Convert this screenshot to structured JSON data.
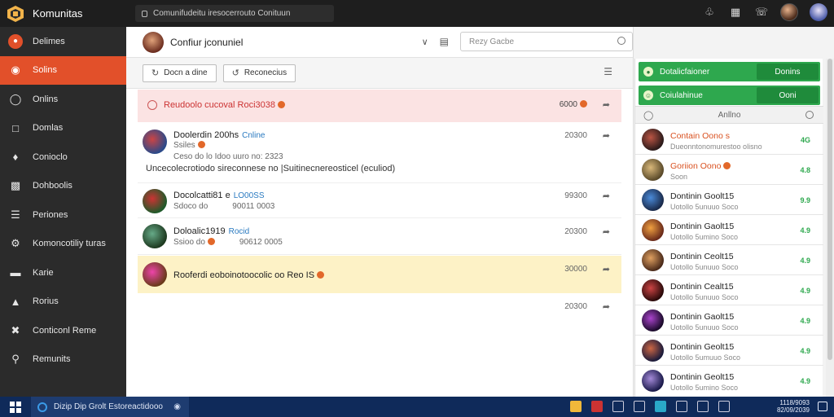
{
  "app": {
    "brand": "Komunitas",
    "url": "Comunifudeitu iresocerrouto Conituun"
  },
  "colors": {
    "accent": "#e2502a",
    "green": "#2ea84e",
    "alert_bg": "#fbe3e3",
    "highlight_bg": "#fdf2c6"
  },
  "sidebar": {
    "items": [
      {
        "label": "Delimes",
        "icon": "home-icon"
      },
      {
        "label": "Solins",
        "icon": "chat-icon",
        "active": true
      },
      {
        "label": "Onlins",
        "icon": "circle-icon"
      },
      {
        "label": "Domlas",
        "icon": "chat-bubble-icon"
      },
      {
        "label": "Conioclo",
        "icon": "puzzle-icon"
      },
      {
        "label": "Dohboolis",
        "icon": "chart-icon"
      },
      {
        "label": "Periones",
        "icon": "list-icon"
      },
      {
        "label": "Komoncotiliy turas",
        "icon": "gear-icon"
      },
      {
        "label": "Karie",
        "icon": "card-icon"
      },
      {
        "label": "Rorius",
        "icon": "image-icon"
      },
      {
        "label": "Conticonl Reme",
        "icon": "wrench-icon"
      },
      {
        "label": "Remunits",
        "icon": "pin-icon"
      }
    ]
  },
  "header": {
    "title": "Confiur jconuniel",
    "search_placeholder": "Rezy Gacbe"
  },
  "toolbar": {
    "btn1": "Docn a dine",
    "btn2": "Reconecius"
  },
  "messages": [
    {
      "type": "alert",
      "text": "Reudoolo cucoval Roci3038",
      "time": "6000"
    },
    {
      "name": "Doolerdin 200hs",
      "tag": "Cnline",
      "sub1": "Ssiles",
      "sub2": "Ceso do lo Idoo uuro no: 2323",
      "body": "Uncecolecrotiodo sireconnese no  |Suitinecnereosticel (eculiod)",
      "time": "20300"
    },
    {
      "name": "Docolcatti81 e",
      "tag": "LO00SS",
      "sub1": "Sdoco do",
      "sub2": "90011 0003",
      "time": "99300"
    },
    {
      "name": "Doloalic1919",
      "tag": "Rocid",
      "sub1": "Ssioo do",
      "sub2": "90612 0005",
      "time": "20300"
    },
    {
      "type": "highlight",
      "text": "Rooferdi eoboinotoocolic oo  Reo IS",
      "time": "30000"
    },
    {
      "time": "20300"
    }
  ],
  "rpanel": {
    "bar1": {
      "label": "Dotalicfaioner",
      "btn": "Donins"
    },
    "bar2": {
      "label": "Coiulahinue",
      "btn": "Ooni"
    },
    "head": "Anllno",
    "items": [
      {
        "name": "Contain Oono",
        "suffix": "s",
        "sub": "Dueonntonomurestoo olisno",
        "badge": "4G",
        "hl": true
      },
      {
        "name": "Goriion Oono",
        "sub": "Soon",
        "badge": "4.8",
        "hl": true
      },
      {
        "name": "Dontinin Goolt15",
        "sub": "Uotollo 5unuuo Soco",
        "badge": "9.9"
      },
      {
        "name": "Dontinin Gaolt15",
        "sub": "Uotollo 5umino Soco",
        "badge": "4.9"
      },
      {
        "name": "Dontinin Ceolt15",
        "sub": "Uotollo 5unuuo Soco",
        "badge": "4.9"
      },
      {
        "name": "Dontinin Cealt15",
        "sub": "Uotollo 5unuuo Soco",
        "badge": "4.9"
      },
      {
        "name": "Dontinin Gaolt15",
        "sub": "Uotollo 5unuuo Soco",
        "badge": "4.9"
      },
      {
        "name": "Dontinin Geolt15",
        "sub": "Uotollo 5umuuo Soco",
        "badge": "4.9"
      },
      {
        "name": "Dontinin Geolt15",
        "sub": "Uotollo 5umino Soco",
        "badge": "4.9"
      }
    ]
  },
  "taskbar": {
    "search": "Dizip Dip Grolt Estoreactidooo",
    "clock_time": "1118/9093",
    "clock_date": "82/09/2039"
  }
}
